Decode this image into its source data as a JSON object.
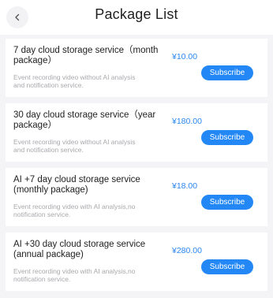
{
  "header": {
    "title": "Package List",
    "back_icon": "chevron-left-icon"
  },
  "colors": {
    "accent": "#2388f5",
    "price": "#2a86f3",
    "background": "#f4f4f6",
    "card": "#ffffff",
    "muted_text": "#a9a9ae"
  },
  "packages": [
    {
      "name": "7 day cloud storage service（month package）",
      "description": "Event recording video without AI analysis and notification service.",
      "price": "¥10.00",
      "button_label": "Subscribe"
    },
    {
      "name": "30 day cloud storage service（year package）",
      "description": "Event recording video without AI analysis and notification service.",
      "price": "¥180.00",
      "button_label": "Subscribe"
    },
    {
      "name": "AI +7 day cloud storage service (monthly package)",
      "description": "Event recording video with AI analysis,no notification service.",
      "price": "¥18.00",
      "button_label": "Subscribe"
    },
    {
      "name": "AI +30 day cloud storage service (annual package)",
      "description": "Event recording video with AI analysis,no notification service.",
      "price": "¥280.00",
      "button_label": "Subscribe"
    }
  ]
}
